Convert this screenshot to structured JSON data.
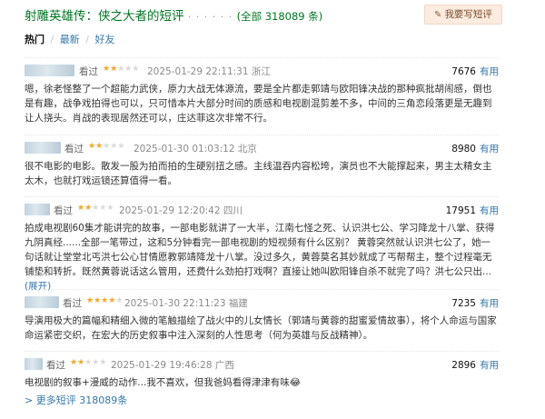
{
  "header": {
    "title": "射雕英雄传：侠之大者的短评",
    "dots": "· · · · · ·",
    "total": "(全部 318089 条)",
    "write_button": "我要写短评",
    "write_icon": "pencil-icon"
  },
  "tabs": [
    {
      "label": "热门",
      "active": true
    },
    {
      "label": "最新",
      "active": false
    },
    {
      "label": "好友",
      "active": false
    }
  ],
  "tab_separator": "/",
  "comments": [
    {
      "status": "看过",
      "rating": 2,
      "time": "2025-01-29 22:11:31",
      "location": "浙江",
      "votes": "7676",
      "useful_label": "有用",
      "text": "嗯，徐老怪整了一个超能力武侠，原力大战无体源流，要是全片都走郭靖与欧阳锋决战的那种疯批胡闹感，倒也是有趣，战争戏拍得也可以，只可惜本片大部分时间的质感和电视剧混剪差不多，中间的三角恋段落更是无趣到让人挠头。肖战的表现居然还可以，庄达菲这次非常不行。",
      "expand": ""
    },
    {
      "status": "看过",
      "rating": 2,
      "time": "2025-01-30 01:03:12",
      "location": "北京",
      "votes": "8980",
      "useful_label": "有用",
      "text": "很不电影的电影。散发一股为拍而拍的生硬别扭之感。主线温吞内容松垮，演员也不大能撑起来，男主太精女主太木，也就打戏运镜还算值得一看。",
      "expand": ""
    },
    {
      "status": "看过",
      "rating": 2,
      "time": "2025-01-29 12:20:42",
      "location": "四川",
      "votes": "17951",
      "useful_label": "有用",
      "text": "拍成电视剧60集才能讲完的故事，一部电影就讲了一大半，江南七怪之死、认识洪七公、学习降龙十八掌、获得九阴真经......全部一笔带过，这和5分钟看完一部电视剧的短视频有什么区别？ 黄蓉突然就认识洪七公了，她一句话就让堂堂北丐洪七公心甘情愿教郭靖降龙十八掌。没过多久，黄蓉莫名其妙就成了丐帮帮主，整个过程毫无铺垫和转折。既然黄蓉说话这么管用，还费什么劲拍打戏啊？直接让她叫欧阳锋自杀不就完了吗？洪七公只出...",
      "expand": "(展开)"
    },
    {
      "status": "看过",
      "rating": 4,
      "time": "2025-01-30 22:11:23",
      "location": "福建",
      "votes": "7235",
      "useful_label": "有用",
      "text": "导演用极大的篇幅和精细入微的笔触描绘了战火中的儿女情长（郭靖与黄蓉的甜蜜爱情故事），将个人命运与国家命运紧密交织，在宏大的历史叙事中注入深刻的人性思考（何为英雄与反战精神）。",
      "expand": ""
    },
    {
      "status": "看过",
      "rating": 2,
      "time": "2025-01-29 19:46:28",
      "location": "广西",
      "votes": "2896",
      "useful_label": "有用",
      "text": "电视剧的叙事+漫威的动作...我不喜欢，但我爸妈看得津津有味😂",
      "expand": ""
    }
  ],
  "more_link": "> 更多短评 318089条",
  "colors": {
    "title_green": "#007722",
    "link_blue": "#3377aa",
    "star_on": "#f5a623",
    "star_off": "#d9d9d9",
    "button_bg": "#fcecdf"
  }
}
